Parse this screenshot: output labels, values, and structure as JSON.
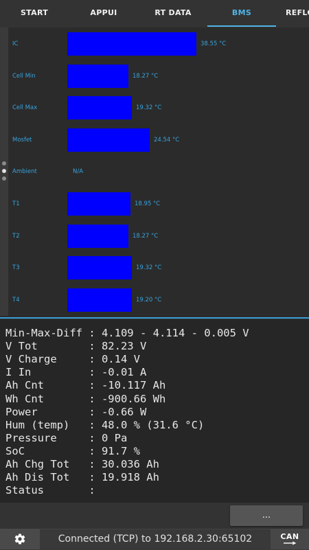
{
  "tabs": [
    {
      "label": "START",
      "active": false
    },
    {
      "label": "APPUI",
      "active": false
    },
    {
      "label": "RT DATA",
      "active": false
    },
    {
      "label": "BMS",
      "active": true
    },
    {
      "label": "REFLO",
      "active": false
    }
  ],
  "accent_color": "#4fb3e6",
  "bar_color": "#0000ff",
  "bars": [
    {
      "label": "IC",
      "value_text": "38.55 °C",
      "value": 38.55
    },
    {
      "label": "Cell Min",
      "value_text": "18.27 °C",
      "value": 18.27
    },
    {
      "label": "Cell Max",
      "value_text": "19.32 °C",
      "value": 19.32
    },
    {
      "label": "Mosfet",
      "value_text": "24.54 °C",
      "value": 24.54
    },
    {
      "label": "Ambient",
      "value_text": "N/A",
      "value": null
    },
    {
      "label": "T1",
      "value_text": "18.95 °C",
      "value": 18.95
    },
    {
      "label": "T2",
      "value_text": "18.27 °C",
      "value": 18.27
    },
    {
      "label": "T3",
      "value_text": "19.32 °C",
      "value": 19.32
    },
    {
      "label": "T4",
      "value_text": "19.20 °C",
      "value": 19.2
    }
  ],
  "data_lines": [
    "Min-Max-Diff : 4.109 - 4.114 - 0.005 V",
    "V Tot        : 82.23 V",
    "V Charge     : 0.14 V",
    "I In         : -0.01 A",
    "Ah Cnt       : -10.117 Ah",
    "Wh Cnt       : -900.66 Wh",
    "Power        : -0.66 W",
    "Hum (temp)   : 48.0 % (31.6 °C)",
    "Pressure     : 0 Pa",
    "SoC          : 91.7 %",
    "Ah Chg Tot   : 30.036 Ah",
    "Ah Dis Tot   : 19.918 Ah",
    "Status       : "
  ],
  "more_button": "...",
  "status": {
    "text": "Connected (TCP) to 192.168.2.30:65102",
    "settings_icon": "gear-icon",
    "can_label": "CAN"
  }
}
